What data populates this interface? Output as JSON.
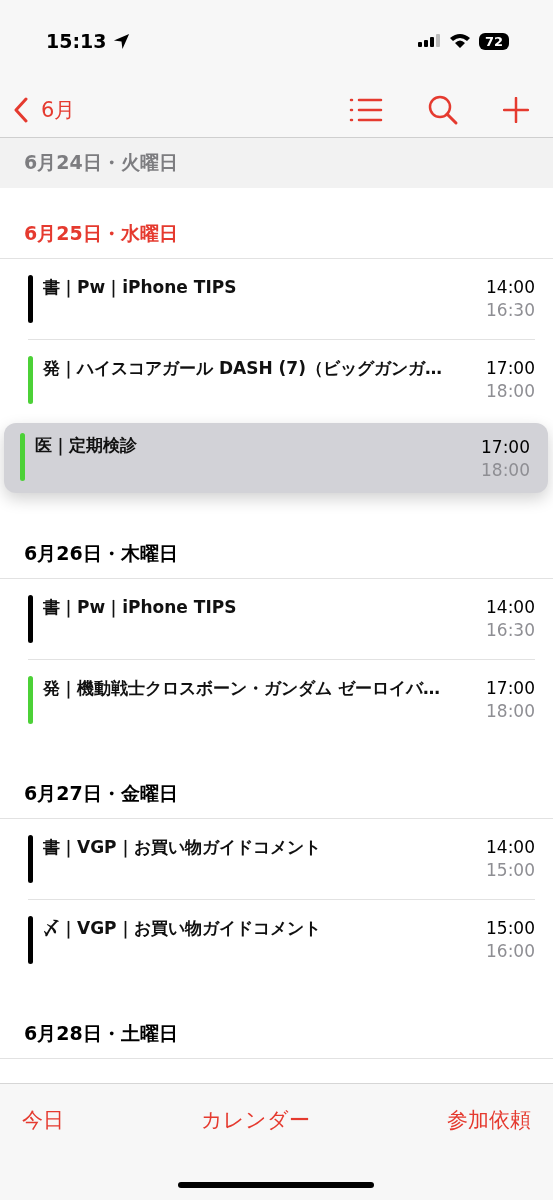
{
  "status_bar": {
    "time": "15:13",
    "battery": "72"
  },
  "nav": {
    "back_label": "6月"
  },
  "pinned_header": {
    "date": "6月24日・火曜日"
  },
  "sections": [
    {
      "date": "6月25日・水曜日",
      "today": true,
      "events": [
        {
          "title": "書｜Pw｜iPhone TIPS",
          "start": "14:00",
          "end": "16:30",
          "color": "#000000",
          "selected": false
        },
        {
          "title": "発｜ハイスコアガール DASH (7)（ビッグガンガ…",
          "start": "17:00",
          "end": "18:00",
          "color": "#4cd137",
          "selected": false
        },
        {
          "title": "医｜定期検診",
          "start": "17:00",
          "end": "18:00",
          "color": "#4cd137",
          "selected": true
        }
      ]
    },
    {
      "date": "6月26日・木曜日",
      "today": false,
      "events": [
        {
          "title": "書｜Pw｜iPhone TIPS",
          "start": "14:00",
          "end": "16:30",
          "color": "#000000",
          "selected": false
        },
        {
          "title": "発｜機動戦士クロスボーン・ガンダム ゼーロイバ…",
          "start": "17:00",
          "end": "18:00",
          "color": "#4cd137",
          "selected": false
        }
      ]
    },
    {
      "date": "6月27日・金曜日",
      "today": false,
      "events": [
        {
          "title": "書｜VGP｜お買い物ガイドコメント",
          "start": "14:00",
          "end": "15:00",
          "color": "#000000",
          "selected": false
        },
        {
          "title": "〆｜VGP｜お買い物ガイドコメント",
          "start": "15:00",
          "end": "16:00",
          "color": "#000000",
          "selected": false
        }
      ]
    },
    {
      "date": "6月28日・土曜日",
      "today": false
    }
  ],
  "tab_bar": [
    "今日",
    "カレンダー",
    "参加依頼"
  ]
}
